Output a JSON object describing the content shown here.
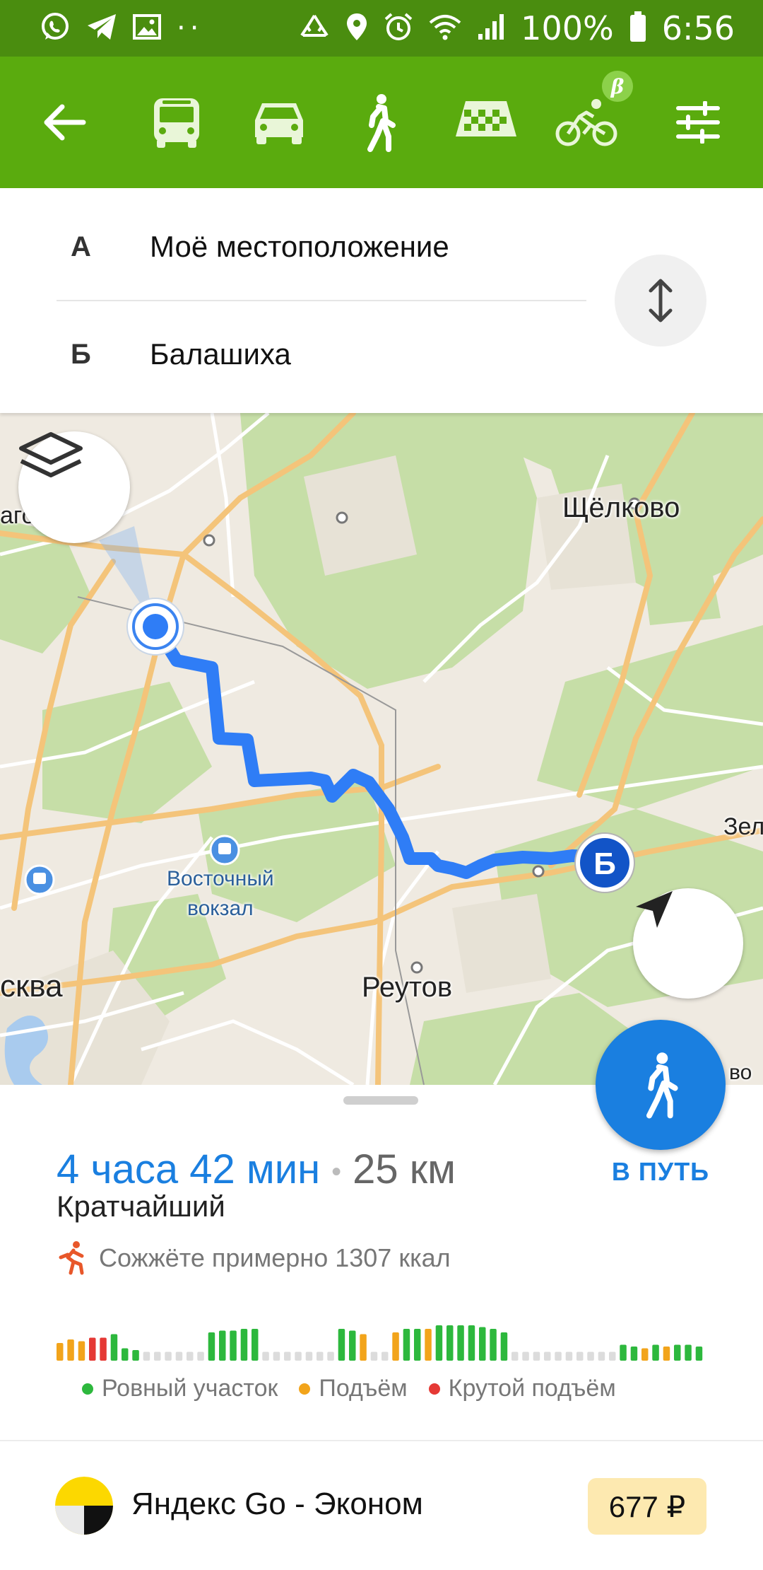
{
  "status_bar": {
    "icons": [
      "whatsapp-icon",
      "telegram-icon",
      "gallery-icon",
      "recycle-icon",
      "location-icon",
      "alarm-icon",
      "wifi-icon",
      "signal-icon",
      "battery-icon"
    ],
    "dots": "··",
    "battery": "100%",
    "time": "6:56"
  },
  "toolbar": {
    "modes": [
      "bus",
      "car",
      "pedestrian",
      "taxi",
      "bicycle"
    ],
    "selected_mode": "pedestrian",
    "beta_badge": "β",
    "accent": "#5aab0e"
  },
  "route": {
    "point_a": {
      "letter": "А",
      "name": "Моё местоположение"
    },
    "point_b": {
      "letter": "Б",
      "name": "Балашиха"
    }
  },
  "map": {
    "labels": {
      "gornoe": "агорное",
      "shchelkovo": "Щёлково",
      "vostochny": "Восточный",
      "vokzal": "вокзал",
      "moskva": "сква",
      "reutov": "Реутов",
      "zel": "Зел",
      "edge": "во"
    },
    "marker_b": "Б",
    "route_color": "#2f7df6"
  },
  "summary": {
    "duration": "4 часа 42 мин",
    "separator": "•",
    "distance": "25 км",
    "variant": "Кратчайший",
    "calories": "Сожжёте примерно 1307 ккал"
  },
  "go_button": {
    "label": "В ПУТЬ"
  },
  "elevation": {
    "colors": {
      "flat": "#2db83d",
      "ascent": "#f2a41b",
      "steep": "#e53935",
      "empty": "#dcdcdc"
    },
    "segments": [
      [
        "ascent",
        0.5
      ],
      [
        "ascent",
        0.6
      ],
      [
        "ascent",
        0.55
      ],
      [
        "steep",
        0.65
      ],
      [
        "steep",
        0.65
      ],
      [
        "flat",
        0.75
      ],
      [
        "flat",
        0.35
      ],
      [
        "flat",
        0.3
      ],
      [
        "empty",
        0.25
      ],
      [
        "empty",
        0.25
      ],
      [
        "empty",
        0.25
      ],
      [
        "empty",
        0.25
      ],
      [
        "empty",
        0.25
      ],
      [
        "empty",
        0.25
      ],
      [
        "flat",
        0.8
      ],
      [
        "flat",
        0.85
      ],
      [
        "flat",
        0.85
      ],
      [
        "flat",
        0.9
      ],
      [
        "flat",
        0.9
      ],
      [
        "empty",
        0.25
      ],
      [
        "empty",
        0.25
      ],
      [
        "empty",
        0.25
      ],
      [
        "empty",
        0.25
      ],
      [
        "empty",
        0.25
      ],
      [
        "empty",
        0.25
      ],
      [
        "empty",
        0.25
      ],
      [
        "flat",
        0.9
      ],
      [
        "flat",
        0.85
      ],
      [
        "ascent",
        0.75
      ],
      [
        "empty",
        0.25
      ],
      [
        "empty",
        0.25
      ],
      [
        "ascent",
        0.8
      ],
      [
        "flat",
        0.9
      ],
      [
        "flat",
        0.9
      ],
      [
        "ascent",
        0.9
      ],
      [
        "flat",
        1.0
      ],
      [
        "flat",
        1.0
      ],
      [
        "flat",
        1.0
      ],
      [
        "flat",
        1.0
      ],
      [
        "flat",
        0.95
      ],
      [
        "flat",
        0.9
      ],
      [
        "flat",
        0.8
      ],
      [
        "empty",
        0.25
      ],
      [
        "empty",
        0.25
      ],
      [
        "empty",
        0.25
      ],
      [
        "empty",
        0.25
      ],
      [
        "empty",
        0.25
      ],
      [
        "empty",
        0.25
      ],
      [
        "empty",
        0.25
      ],
      [
        "empty",
        0.25
      ],
      [
        "empty",
        0.25
      ],
      [
        "empty",
        0.25
      ],
      [
        "flat",
        0.45
      ],
      [
        "flat",
        0.4
      ],
      [
        "ascent",
        0.35
      ],
      [
        "flat",
        0.45
      ],
      [
        "ascent",
        0.4
      ],
      [
        "flat",
        0.45
      ],
      [
        "flat",
        0.45
      ],
      [
        "flat",
        0.4
      ]
    ],
    "legend": {
      "flat": "Ровный участок",
      "ascent": "Подъём",
      "steep": "Крутой подъём"
    }
  },
  "taxi": {
    "name": "Яндекс Go - Эконом",
    "price": "677 ₽"
  }
}
